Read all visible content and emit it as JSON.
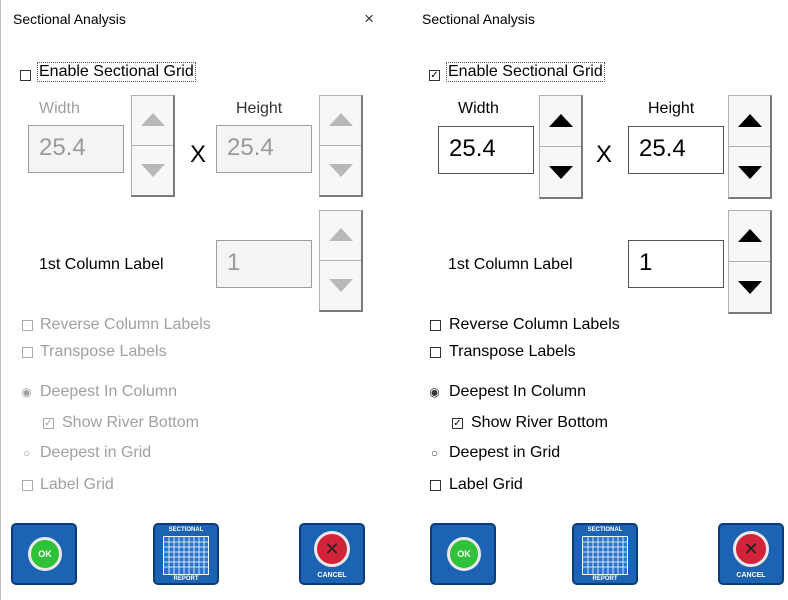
{
  "window": {
    "title": "Sectional Analysis",
    "close_glyph": "×"
  },
  "enable_checkbox": {
    "label": "Enable Sectional Grid"
  },
  "size": {
    "width_label": "Width",
    "height_label": "Height",
    "separator": "X"
  },
  "column_label_field": {
    "label": "1st Column Label"
  },
  "options": {
    "reverse_label": "Reverse Column Labels",
    "transpose_label": "Transpose Labels",
    "deepest_column_label": "Deepest In Column",
    "show_river_bottom_label": "Show River Bottom",
    "deepest_grid_label": "Deepest in Grid",
    "label_grid_label": "Label Grid"
  },
  "buttons": {
    "ok_label": "OK",
    "report_top": "SECTIONAL",
    "report_bottom": "REPORT",
    "cancel_label": "CANCEL"
  },
  "panels": {
    "left": {
      "enabled": false,
      "width_value": "25.4",
      "height_value": "25.4",
      "column_label_value": "1",
      "enable_checked": "",
      "reverse_checked": "",
      "transpose_checked": "",
      "deepest_column_selected": "◉",
      "show_river_bottom_checked": "✓",
      "deepest_grid_selected": "○",
      "label_grid_checked": ""
    },
    "right": {
      "enabled": true,
      "width_value": "25.4",
      "height_value": "25.4",
      "column_label_value": "1",
      "enable_checked": "✓",
      "reverse_checked": "",
      "transpose_checked": "",
      "deepest_column_selected": "◉",
      "show_river_bottom_checked": "✓",
      "deepest_grid_selected": "○",
      "label_grid_checked": ""
    }
  },
  "colors": {
    "button_blue": "#1d63b3",
    "ok_green": "#2fc13a",
    "cancel_red": "#d3233a",
    "disabled_text": "#a0a0a0"
  },
  "icons": {
    "ok": "ok-circle-icon",
    "report": "sectional-report-grid-icon",
    "cancel": "cancel-x-icon",
    "spinner_up": "triangle-up-icon",
    "spinner_down": "triangle-down-icon"
  }
}
